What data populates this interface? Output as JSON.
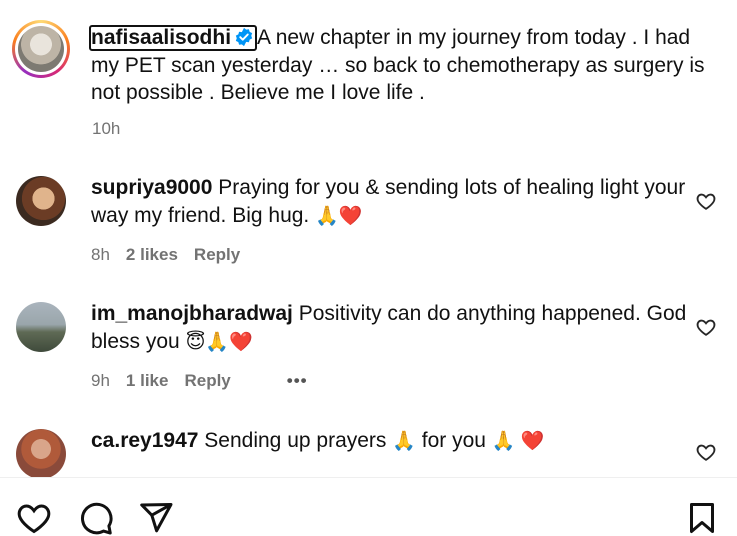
{
  "post": {
    "username": "nafisaalisodhi",
    "caption": "A new chapter in my journey from today . I had my PET scan yesterday … so back to chemotherapy as surgery is not possible . Believe me I love life .",
    "time": "10h"
  },
  "comments": [
    {
      "username": "supriya9000",
      "text": "Praying for you & sending lots of healing light your way my friend. Big hug.",
      "emojis": "🙏❤️",
      "time": "8h",
      "likes": "2 likes",
      "reply": "Reply"
    },
    {
      "username": "im_manojbharadwaj",
      "text": "Positivity can do anything happened. God bless you",
      "emojis": "😇🙏❤️",
      "time": "9h",
      "likes": "1 like",
      "reply": "Reply",
      "more": "•••"
    },
    {
      "username": "ca.rey1947",
      "text_part1": "Sending up prayers",
      "emoji1": "🙏",
      "text_part2": "for you",
      "emoji2": "🙏 ❤️"
    }
  ],
  "actions": {
    "icons": [
      "heart-icon",
      "comment-icon",
      "share-icon",
      "bookmark-icon"
    ]
  }
}
